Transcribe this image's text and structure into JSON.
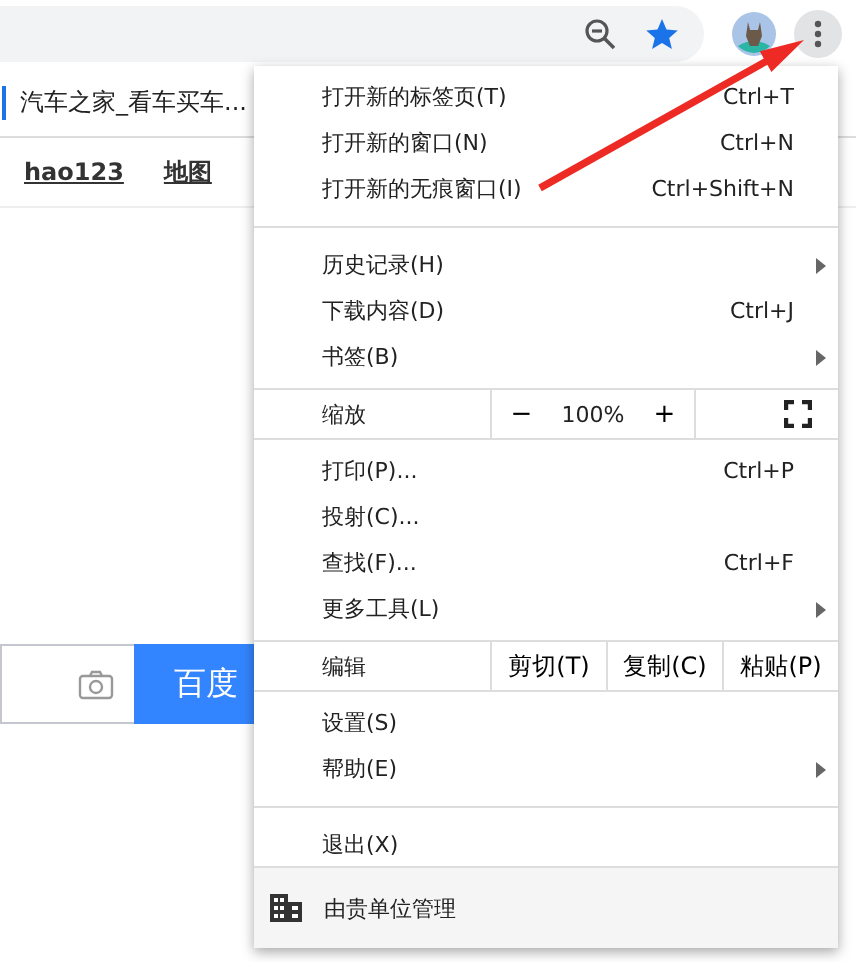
{
  "toolbar": {
    "bookmark": "汽车之家_看车买车..."
  },
  "nav_links": [
    "hao123",
    "地图"
  ],
  "search": {
    "button": "百度"
  },
  "menu": {
    "items": [
      {
        "kind": "item",
        "label": "打开新的标签页(T)",
        "shortcut": "Ctrl+T"
      },
      {
        "kind": "item",
        "label": "打开新的窗口(N)",
        "shortcut": "Ctrl+N"
      },
      {
        "kind": "item",
        "label": "打开新的无痕窗口(I)",
        "shortcut": "Ctrl+Shift+N"
      },
      {
        "kind": "divider"
      },
      {
        "kind": "item",
        "label": "历史记录(H)",
        "submenu": true
      },
      {
        "kind": "item",
        "label": "下载内容(D)",
        "shortcut": "Ctrl+J"
      },
      {
        "kind": "item",
        "label": "书签(B)",
        "submenu": true
      },
      {
        "kind": "zoom",
        "label": "缩放",
        "minus": "−",
        "value": "100%",
        "plus": "+"
      },
      {
        "kind": "item",
        "label": "打印(P)...",
        "shortcut": "Ctrl+P"
      },
      {
        "kind": "item",
        "label": "投射(C)..."
      },
      {
        "kind": "item",
        "label": "查找(F)...",
        "shortcut": "Ctrl+F"
      },
      {
        "kind": "item",
        "label": "更多工具(L)",
        "submenu": true
      },
      {
        "kind": "edit",
        "label": "编辑",
        "actions": [
          "剪切(T)",
          "复制(C)",
          "粘贴(P)"
        ]
      },
      {
        "kind": "item",
        "label": "设置(S)"
      },
      {
        "kind": "item",
        "label": "帮助(E)",
        "submenu": true
      },
      {
        "kind": "divider"
      },
      {
        "kind": "item",
        "label": "退出(X)"
      },
      {
        "kind": "managed",
        "label": "由贵单位管理"
      }
    ]
  }
}
